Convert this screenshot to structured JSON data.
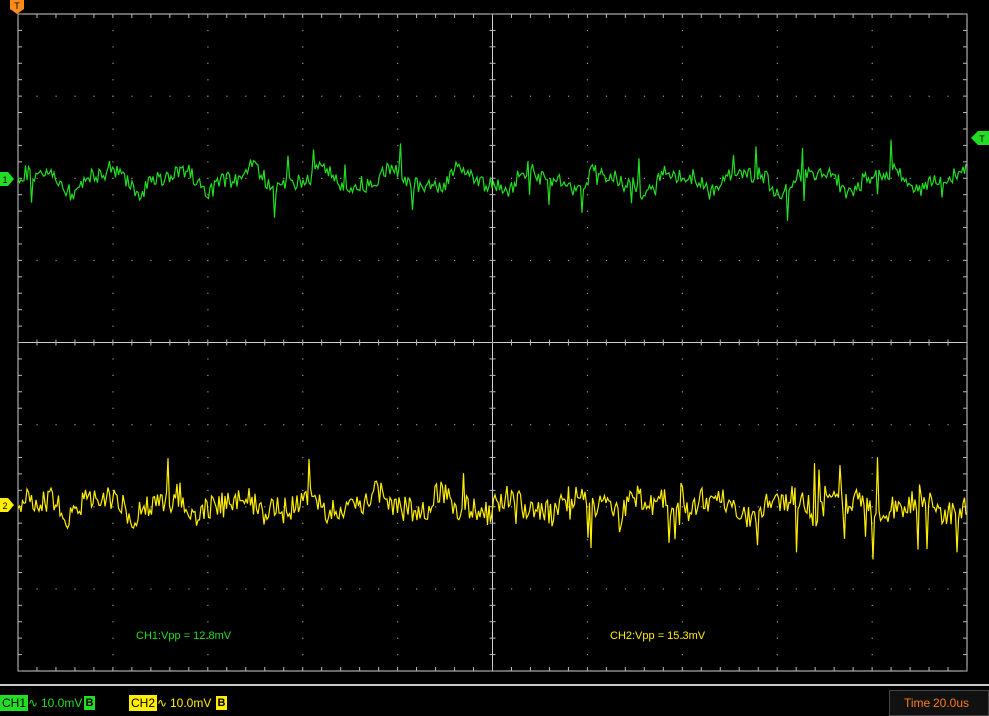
{
  "colors": {
    "background": "#000000",
    "grid": "#ffffff",
    "ch1": "#22dd22",
    "ch2": "#ffee00",
    "time": "#ff7a1a",
    "trigger": "#ff8c1a"
  },
  "markers": {
    "trigger_top": "T",
    "trigger_right": "T",
    "ch1": "1",
    "ch2": "2"
  },
  "measurements": {
    "ch1": "CH1:Vpp = 12.8mV",
    "ch2": "CH2:Vpp = 15.3mV"
  },
  "status": {
    "ch1": {
      "label": "CH1",
      "coupling_icon": "ac-coupling-icon",
      "coupling_glyph": "∿",
      "scale": "10.0mV",
      "bw": "B"
    },
    "ch2": {
      "label": "CH2",
      "coupling_icon": "ac-coupling-icon",
      "coupling_glyph": "∿",
      "scale": "10.0mV",
      "bw": "B"
    },
    "time_label": "Time",
    "time_value": "20.0us"
  }
}
